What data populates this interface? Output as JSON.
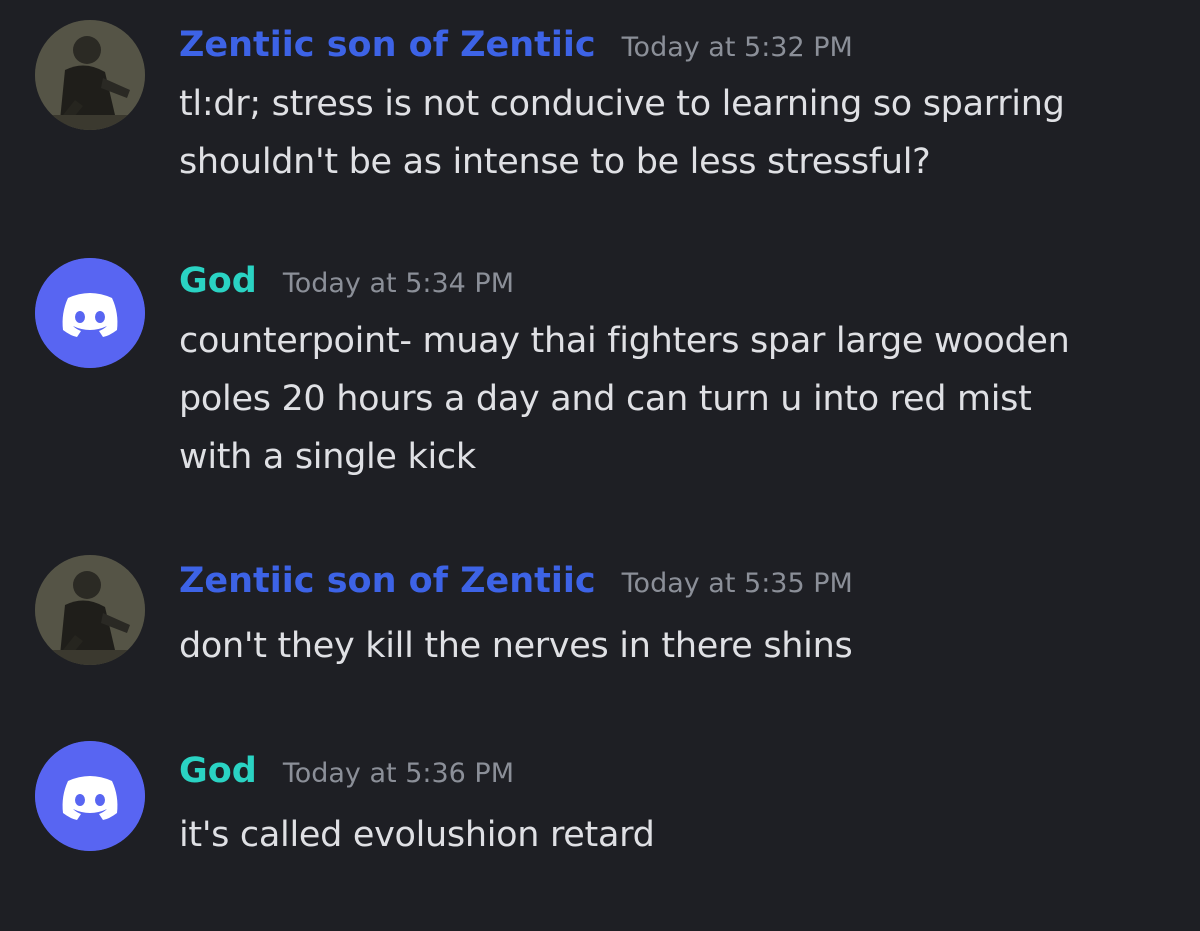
{
  "messages": [
    {
      "author": "Zentiic son of Zentiic",
      "timestamp": "Today at 5:32 PM",
      "avatar": "photo-avatar",
      "lines": [
        "tl:dr; stress is not conducive to learning so sparring",
        "shouldn't be as intense to be less stressful?"
      ]
    },
    {
      "author": "God",
      "timestamp": "Today at 5:34 PM",
      "avatar": "discord-icon",
      "lines": [
        "counterpoint- muay thai fighters spar large wooden",
        "poles 20 hours a day and can turn u into red mist",
        "with a single kick"
      ]
    },
    {
      "author": "Zentiic son of Zentiic",
      "timestamp": "Today at 5:35 PM",
      "avatar": "photo-avatar",
      "lines": [
        "don't they kill the nerves in there shins"
      ]
    },
    {
      "author": "God",
      "timestamp": "Today at 5:36 PM",
      "avatar": "discord-icon",
      "lines": [
        "it's called evolushion retard"
      ]
    }
  ],
  "colors": {
    "background": "#1e1f24",
    "zentiic_name": "#3d63e6",
    "god_name": "#2ad3c3",
    "discord_blurple": "#5865f2",
    "timestamp": "#8b8f98",
    "message_text": "#dfe0e4"
  }
}
